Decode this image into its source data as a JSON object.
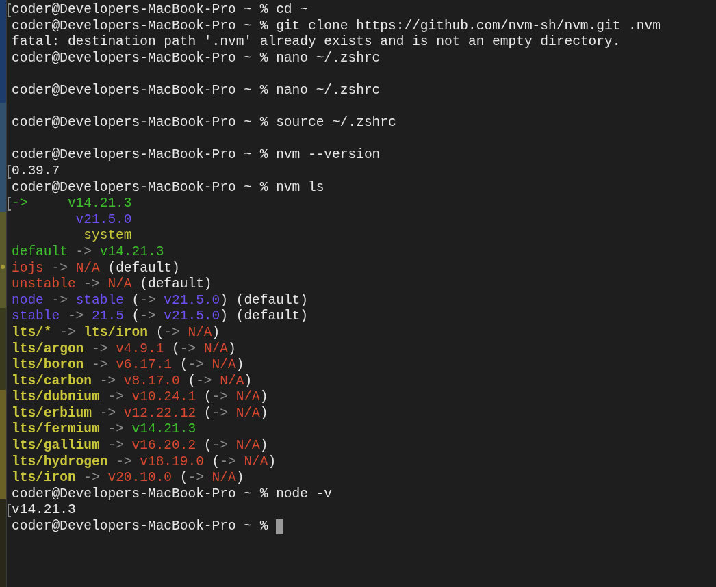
{
  "terminal": {
    "lines": [
      {
        "kind": "text",
        "marked": true,
        "cursor": false,
        "segments": [
          {
            "text": "coder@Developers-MacBook-Pro ~ % cd ~",
            "kind": "plain"
          }
        ]
      },
      {
        "kind": "text",
        "marked": false,
        "cursor": false,
        "segments": [
          {
            "text": "coder@Developers-MacBook-Pro ~ % git clone https://github.com/nvm-sh/nvm.git .nvm",
            "kind": "plain"
          }
        ]
      },
      {
        "kind": "text",
        "marked": false,
        "cursor": false,
        "segments": [
          {
            "text": "fatal: destination path '.nvm' already exists and is not an empty directory.",
            "kind": "plain"
          }
        ]
      },
      {
        "kind": "text",
        "marked": false,
        "cursor": false,
        "segments": [
          {
            "text": "coder@Developers-MacBook-Pro ~ % nano ~/.zshrc",
            "kind": "plain"
          }
        ]
      },
      {
        "kind": "blank",
        "marked": false,
        "cursor": false
      },
      {
        "kind": "text",
        "marked": false,
        "cursor": false,
        "segments": [
          {
            "text": "coder@Developers-MacBook-Pro ~ % nano ~/.zshrc",
            "kind": "plain"
          }
        ]
      },
      {
        "kind": "blank",
        "marked": false,
        "cursor": false
      },
      {
        "kind": "text",
        "marked": false,
        "cursor": false,
        "segments": [
          {
            "text": "coder@Developers-MacBook-Pro ~ % source ~/.zshrc",
            "kind": "plain"
          }
        ]
      },
      {
        "kind": "blank",
        "marked": false,
        "cursor": false
      },
      {
        "kind": "text",
        "marked": false,
        "cursor": false,
        "segments": [
          {
            "text": "coder@Developers-MacBook-Pro ~ % nvm --version",
            "kind": "plain"
          }
        ]
      },
      {
        "kind": "text",
        "marked": true,
        "cursor": false,
        "segments": [
          {
            "text": "0.39.7",
            "kind": "plain"
          }
        ]
      },
      {
        "kind": "text",
        "marked": false,
        "cursor": false,
        "segments": [
          {
            "text": "coder@Developers-MacBook-Pro ~ % nvm ls",
            "kind": "plain"
          }
        ]
      },
      {
        "kind": "text",
        "marked": true,
        "cursor": false,
        "segments": [
          {
            "text": "->     v14.21.3",
            "kind": "green"
          }
        ]
      },
      {
        "kind": "text",
        "marked": false,
        "cursor": false,
        "segments": [
          {
            "text": "        v21.5.0",
            "kind": "violet"
          }
        ]
      },
      {
        "kind": "text",
        "marked": false,
        "cursor": false,
        "segments": [
          {
            "text": "         system",
            "kind": "yellow"
          }
        ]
      },
      {
        "kind": "text",
        "marked": false,
        "cursor": false,
        "segments": [
          {
            "text": "default",
            "kind": "green"
          },
          {
            "text": " -> ",
            "kind": "dim"
          },
          {
            "text": "v14.21.3",
            "kind": "green"
          }
        ]
      },
      {
        "kind": "text",
        "marked": false,
        "cursor": false,
        "segments": [
          {
            "text": "iojs",
            "kind": "red"
          },
          {
            "text": " -> ",
            "kind": "dim"
          },
          {
            "text": "N/A",
            "kind": "red"
          },
          {
            "text": " (default)",
            "kind": "plain"
          }
        ]
      },
      {
        "kind": "text",
        "marked": false,
        "cursor": false,
        "segments": [
          {
            "text": "unstable",
            "kind": "red"
          },
          {
            "text": " -> ",
            "kind": "dim"
          },
          {
            "text": "N/A",
            "kind": "red"
          },
          {
            "text": " (default)",
            "kind": "plain"
          }
        ]
      },
      {
        "kind": "text",
        "marked": false,
        "cursor": false,
        "segments": [
          {
            "text": "node",
            "kind": "violet"
          },
          {
            "text": " -> ",
            "kind": "dim"
          },
          {
            "text": "stable",
            "kind": "violet"
          },
          {
            "text": " (",
            "kind": "plain"
          },
          {
            "text": "-> ",
            "kind": "dim"
          },
          {
            "text": "v21.5.0",
            "kind": "violet"
          },
          {
            "text": ") (default)",
            "kind": "plain"
          }
        ]
      },
      {
        "kind": "text",
        "marked": false,
        "cursor": false,
        "segments": [
          {
            "text": "stable",
            "kind": "violet"
          },
          {
            "text": " -> ",
            "kind": "dim"
          },
          {
            "text": "21.5",
            "kind": "violet"
          },
          {
            "text": " (",
            "kind": "plain"
          },
          {
            "text": "-> ",
            "kind": "dim"
          },
          {
            "text": "v21.5.0",
            "kind": "violet"
          },
          {
            "text": ") (default)",
            "kind": "plain"
          }
        ]
      },
      {
        "kind": "text",
        "marked": false,
        "cursor": false,
        "segments": [
          {
            "text": "lts/*",
            "kind": "lts"
          },
          {
            "text": " -> ",
            "kind": "dim"
          },
          {
            "text": "lts/iron",
            "kind": "lts"
          },
          {
            "text": " (",
            "kind": "plain"
          },
          {
            "text": "-> ",
            "kind": "dim"
          },
          {
            "text": "N/A",
            "kind": "red"
          },
          {
            "text": ")",
            "kind": "plain"
          }
        ]
      },
      {
        "kind": "text",
        "marked": false,
        "cursor": false,
        "segments": [
          {
            "text": "lts/argon",
            "kind": "lts"
          },
          {
            "text": " -> ",
            "kind": "dim"
          },
          {
            "text": "v4.9.1",
            "kind": "red"
          },
          {
            "text": " (",
            "kind": "plain"
          },
          {
            "text": "-> ",
            "kind": "dim"
          },
          {
            "text": "N/A",
            "kind": "red"
          },
          {
            "text": ")",
            "kind": "plain"
          }
        ]
      },
      {
        "kind": "text",
        "marked": false,
        "cursor": false,
        "segments": [
          {
            "text": "lts/boron",
            "kind": "lts"
          },
          {
            "text": " -> ",
            "kind": "dim"
          },
          {
            "text": "v6.17.1",
            "kind": "red"
          },
          {
            "text": " (",
            "kind": "plain"
          },
          {
            "text": "-> ",
            "kind": "dim"
          },
          {
            "text": "N/A",
            "kind": "red"
          },
          {
            "text": ")",
            "kind": "plain"
          }
        ]
      },
      {
        "kind": "text",
        "marked": false,
        "cursor": false,
        "segments": [
          {
            "text": "lts/carbon",
            "kind": "lts"
          },
          {
            "text": " -> ",
            "kind": "dim"
          },
          {
            "text": "v8.17.0",
            "kind": "red"
          },
          {
            "text": " (",
            "kind": "plain"
          },
          {
            "text": "-> ",
            "kind": "dim"
          },
          {
            "text": "N/A",
            "kind": "red"
          },
          {
            "text": ")",
            "kind": "plain"
          }
        ]
      },
      {
        "kind": "text",
        "marked": false,
        "cursor": false,
        "segments": [
          {
            "text": "lts/dubnium",
            "kind": "lts"
          },
          {
            "text": " -> ",
            "kind": "dim"
          },
          {
            "text": "v10.24.1",
            "kind": "red"
          },
          {
            "text": " (",
            "kind": "plain"
          },
          {
            "text": "-> ",
            "kind": "dim"
          },
          {
            "text": "N/A",
            "kind": "red"
          },
          {
            "text": ")",
            "kind": "plain"
          }
        ]
      },
      {
        "kind": "text",
        "marked": false,
        "cursor": false,
        "segments": [
          {
            "text": "lts/erbium",
            "kind": "lts"
          },
          {
            "text": " -> ",
            "kind": "dim"
          },
          {
            "text": "v12.22.12",
            "kind": "red"
          },
          {
            "text": " (",
            "kind": "plain"
          },
          {
            "text": "-> ",
            "kind": "dim"
          },
          {
            "text": "N/A",
            "kind": "red"
          },
          {
            "text": ")",
            "kind": "plain"
          }
        ]
      },
      {
        "kind": "text",
        "marked": false,
        "cursor": false,
        "segments": [
          {
            "text": "lts/fermium",
            "kind": "lts"
          },
          {
            "text": " -> ",
            "kind": "dim"
          },
          {
            "text": "v14.21.3",
            "kind": "green"
          }
        ]
      },
      {
        "kind": "text",
        "marked": false,
        "cursor": false,
        "segments": [
          {
            "text": "lts/gallium",
            "kind": "lts"
          },
          {
            "text": " -> ",
            "kind": "dim"
          },
          {
            "text": "v16.20.2",
            "kind": "red"
          },
          {
            "text": " (",
            "kind": "plain"
          },
          {
            "text": "-> ",
            "kind": "dim"
          },
          {
            "text": "N/A",
            "kind": "red"
          },
          {
            "text": ")",
            "kind": "plain"
          }
        ]
      },
      {
        "kind": "text",
        "marked": false,
        "cursor": false,
        "segments": [
          {
            "text": "lts/hydrogen",
            "kind": "lts"
          },
          {
            "text": " -> ",
            "kind": "dim"
          },
          {
            "text": "v18.19.0",
            "kind": "red"
          },
          {
            "text": " (",
            "kind": "plain"
          },
          {
            "text": "-> ",
            "kind": "dim"
          },
          {
            "text": "N/A",
            "kind": "red"
          },
          {
            "text": ")",
            "kind": "plain"
          }
        ]
      },
      {
        "kind": "text",
        "marked": false,
        "cursor": false,
        "segments": [
          {
            "text": "lts/iron",
            "kind": "lts"
          },
          {
            "text": " -> ",
            "kind": "dim"
          },
          {
            "text": "v20.10.0",
            "kind": "red"
          },
          {
            "text": " (",
            "kind": "plain"
          },
          {
            "text": "-> ",
            "kind": "dim"
          },
          {
            "text": "N/A",
            "kind": "red"
          },
          {
            "text": ")",
            "kind": "plain"
          }
        ]
      },
      {
        "kind": "text",
        "marked": false,
        "cursor": false,
        "segments": [
          {
            "text": "coder@Developers-MacBook-Pro ~ % node -v",
            "kind": "plain"
          }
        ]
      },
      {
        "kind": "text",
        "marked": true,
        "cursor": false,
        "segments": [
          {
            "text": "v14.21.3",
            "kind": "plain"
          }
        ]
      },
      {
        "kind": "text",
        "marked": false,
        "cursor": true,
        "segments": [
          {
            "text": "coder@Developers-MacBook-Pro ~ %",
            "kind": "plain"
          }
        ]
      }
    ]
  }
}
